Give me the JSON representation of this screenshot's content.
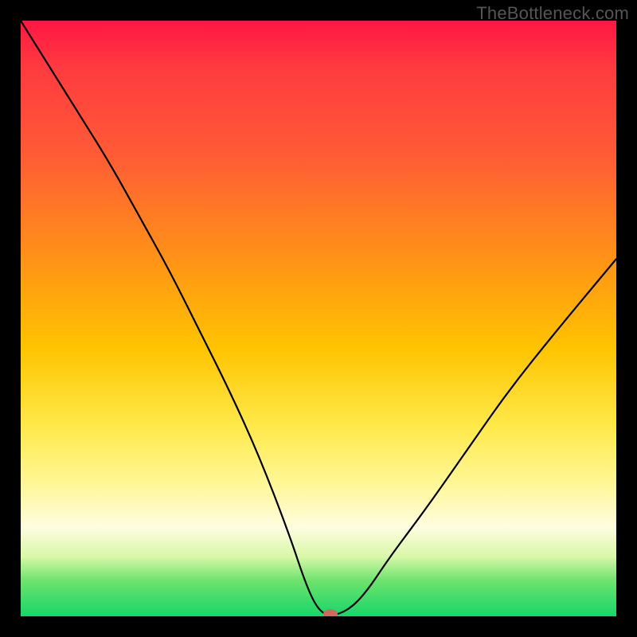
{
  "watermark": "TheBottleneck.com",
  "colors": {
    "frame_background": "#000000",
    "gradient_top": "#ff1744",
    "gradient_mid_orange": "#ff8c1a",
    "gradient_mid_yellow": "#ffe94a",
    "gradient_bottom": "#17d66a",
    "curve": "#000000",
    "marker": "#d06a5a",
    "watermark_text": "#555555"
  },
  "chart_data": {
    "type": "line",
    "title": "",
    "xlabel": "",
    "ylabel": "",
    "xlim": [
      0,
      100
    ],
    "ylim": [
      0,
      100
    ],
    "series": [
      {
        "name": "bottleneck-curve",
        "x": [
          0,
          5,
          10,
          15,
          20,
          25,
          30,
          35,
          40,
          45,
          48,
          50,
          52,
          55,
          58,
          62,
          68,
          75,
          82,
          90,
          100
        ],
        "y": [
          100,
          92,
          84,
          76,
          67,
          58,
          48,
          38,
          27,
          14,
          5,
          1,
          0,
          1,
          4,
          10,
          18,
          28,
          38,
          48,
          60
        ]
      }
    ],
    "marker": {
      "name": "optimal-point",
      "x": 52,
      "y": 0
    },
    "notes": "V-shaped curve descending from top-left to a minimum near x≈52 then rising toward right; background gradient maps high bottleneck (top) red → low (bottom) green."
  }
}
